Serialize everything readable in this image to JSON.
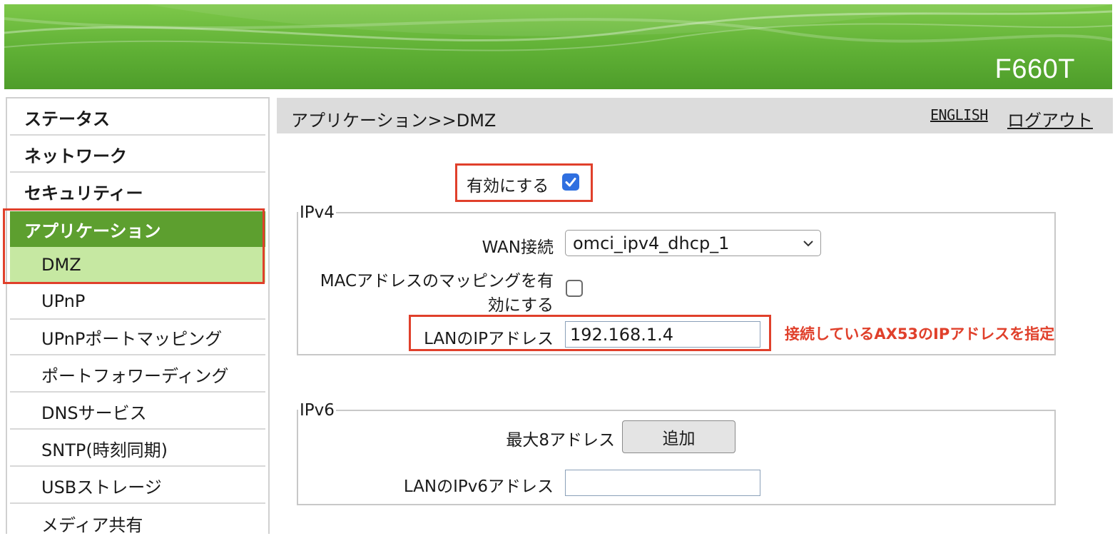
{
  "header": {
    "model": "F660T"
  },
  "sidebar": {
    "items": [
      {
        "label": "ステータス"
      },
      {
        "label": "ネットワーク"
      },
      {
        "label": "セキュリティー"
      },
      {
        "label": "アプリケーション"
      },
      {
        "label": "DMZ"
      },
      {
        "label": "UPnP"
      },
      {
        "label": "UPnPポートマッピング"
      },
      {
        "label": "ポートフォワーディング"
      },
      {
        "label": "DNSサービス"
      },
      {
        "label": "SNTP(時刻同期)"
      },
      {
        "label": "USBストレージ"
      },
      {
        "label": "メディア共有"
      }
    ]
  },
  "topbar": {
    "breadcrumb": "アプリケーション>>DMZ",
    "english": "ENGLISH",
    "logout": "ログアウト"
  },
  "form": {
    "enable_label": "有効にする",
    "enable_checked": true,
    "ipv4": {
      "legend": "IPv4",
      "wan_label": "WAN接続",
      "wan_value": "omci_ipv4_dhcp_1",
      "mac_label_line1": "MACアドレスのマッピングを有",
      "mac_label_line2": "効にする",
      "mac_checked": false,
      "lan_ip_label": "LANのIPアドレス",
      "lan_ip_value": "192.168.1.4"
    },
    "ipv6": {
      "legend": "IPv6",
      "max_label": "最大8アドレス",
      "add_button": "追加",
      "lan_ipv6_label": "LANのIPv6アドレス",
      "lan_ipv6_value": ""
    }
  },
  "annotation": {
    "text": "接続しているAX53のIPアドレスを指定"
  },
  "colors": {
    "accent_red": "#e0402b",
    "nav_active": "#5d9f2f",
    "nav_sub_active": "#c6e8a2",
    "checkbox_blue": "#2f6fe0"
  }
}
